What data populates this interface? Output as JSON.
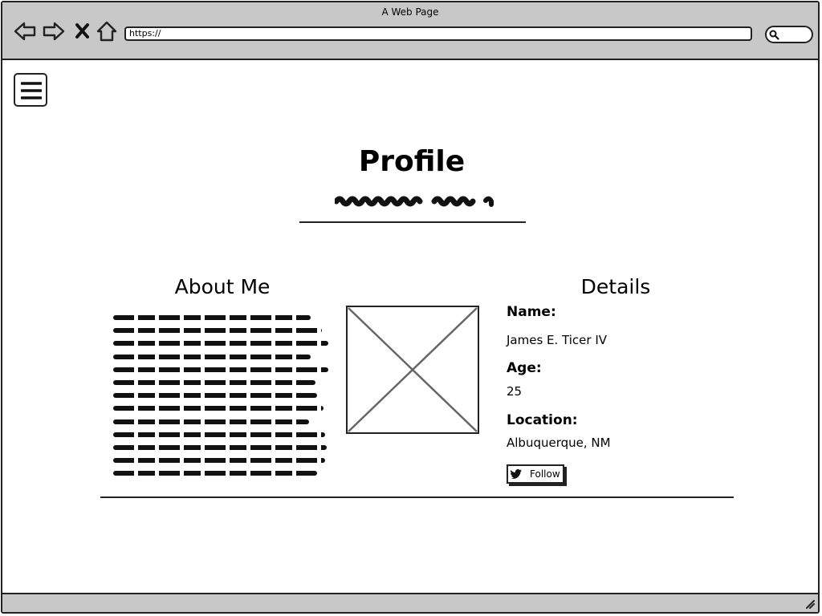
{
  "window": {
    "title": "A Web Page"
  },
  "toolbar": {
    "back_icon": "arrow-left-icon",
    "forward_icon": "arrow-right-icon",
    "stop_icon": "close-icon",
    "home_icon": "home-icon",
    "url_value": "https://",
    "search_icon": "search-icon"
  },
  "menu": {
    "icon": "hamburger-menu-icon"
  },
  "header": {
    "title": "Profile"
  },
  "about": {
    "heading": "About Me",
    "image_icon": "image-placeholder-icon"
  },
  "details": {
    "heading": "Details",
    "name_label": "Name:",
    "name_value": "James E. Ticer IV",
    "age_label": "Age:",
    "age_value": "25",
    "location_label": "Location:",
    "location_value": "Albuquerque, NM",
    "follow_label": "Follow",
    "follow_icon": "twitter-bird-icon"
  }
}
